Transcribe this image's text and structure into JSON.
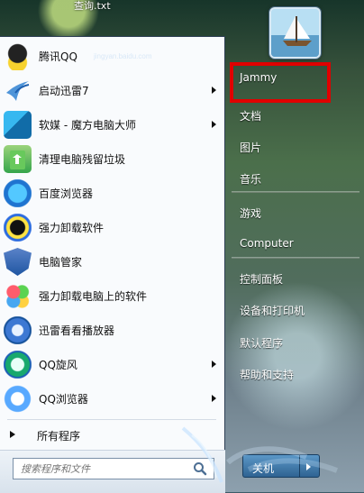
{
  "window": {
    "title": "查询.txt"
  },
  "user": {
    "avatar": "sailboat-avatar"
  },
  "start_menu": {
    "programs": [
      {
        "label": "腾讯QQ",
        "icon": "qq-penguin-icon",
        "has_submenu": false
      },
      {
        "label": "启动迅雷7",
        "icon": "thunder-bird-icon",
        "has_submenu": true
      },
      {
        "label": "软媒 - 魔方电脑大师",
        "icon": "cube-icon",
        "has_submenu": true
      },
      {
        "label": "清理电脑残留垃圾",
        "icon": "recycle-bin-icon",
        "has_submenu": false
      },
      {
        "label": "百度浏览器",
        "icon": "browser-swirl-icon",
        "has_submenu": false
      },
      {
        "label": "强力卸载软件",
        "icon": "uninstall-icon",
        "has_submenu": false
      },
      {
        "label": "电脑管家",
        "icon": "shield-icon",
        "has_submenu": false
      },
      {
        "label": "强力卸载电脑上的软件",
        "icon": "colorful-flower-icon",
        "has_submenu": false
      },
      {
        "label": "迅雷看看播放器",
        "icon": "media-player-icon",
        "has_submenu": false
      },
      {
        "label": "QQ旋风",
        "icon": "qq-whirlwind-icon",
        "has_submenu": true
      },
      {
        "label": "QQ浏览器",
        "icon": "qq-browser-icon",
        "has_submenu": true
      }
    ],
    "all_programs": "所有程序",
    "search_placeholder": "搜索程序和文件"
  },
  "right_panel": {
    "items": [
      "Jammy",
      "文档",
      "图片",
      "音乐",
      "游戏",
      "Computer",
      "控制面板",
      "设备和打印机",
      "默认程序",
      "帮助和支持"
    ]
  },
  "shutdown": {
    "label": "关机"
  },
  "watermark": {
    "site": "jingyan.baidu.com"
  },
  "colors": {
    "highlight": "#e00000",
    "panel_text": "#ffffff",
    "button_blue": "#2f6392"
  }
}
